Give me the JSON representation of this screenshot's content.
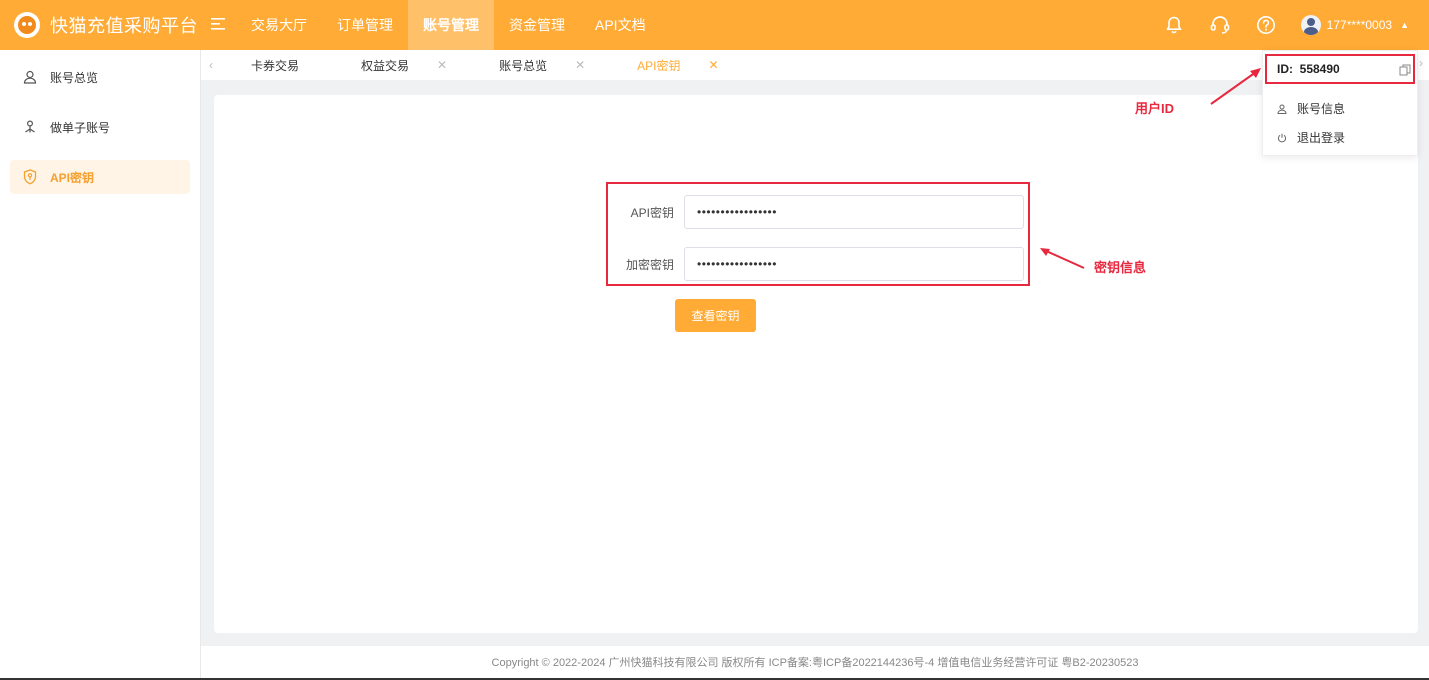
{
  "app": {
    "title": "快猫充值采购平台"
  },
  "nav": {
    "items": [
      {
        "label": "交易大厅"
      },
      {
        "label": "订单管理"
      },
      {
        "label": "账号管理"
      },
      {
        "label": "资金管理"
      },
      {
        "label": "API文档"
      }
    ],
    "active_index": 2
  },
  "user": {
    "phone": "177****0003"
  },
  "sidebar": {
    "items": [
      {
        "label": "账号总览",
        "icon": "user-icon"
      },
      {
        "label": "做单子账号",
        "icon": "sub-account-icon"
      },
      {
        "label": "API密钥",
        "icon": "shield-icon"
      }
    ],
    "active_index": 2
  },
  "tabs": {
    "items": [
      {
        "label": "卡券交易"
      },
      {
        "label": "权益交易"
      },
      {
        "label": "账号总览"
      },
      {
        "label": "API密钥"
      }
    ],
    "active_index": 3
  },
  "form": {
    "api_key_label": "API密钥",
    "api_key_value": "•••••••••••••••••",
    "encrypt_key_label": "加密密钥",
    "encrypt_key_value": "•••••••••••••••••",
    "view_button": "查看密钥"
  },
  "annotations": {
    "key_info": "密钥信息",
    "user_id": "用户ID"
  },
  "dropdown": {
    "id_text": "ID:  558490",
    "account_info": "账号信息",
    "logout": "退出登录"
  },
  "footer": {
    "copyright": "Copyright © 2022-2024 广州快猫科技有限公司 版权所有 ICP备案:粤ICP备2022144236号-4 增值电信业务经营许可证 粤B2-20230523"
  },
  "colors": {
    "brand": "#ffab36",
    "annotation": "#e8283f"
  }
}
